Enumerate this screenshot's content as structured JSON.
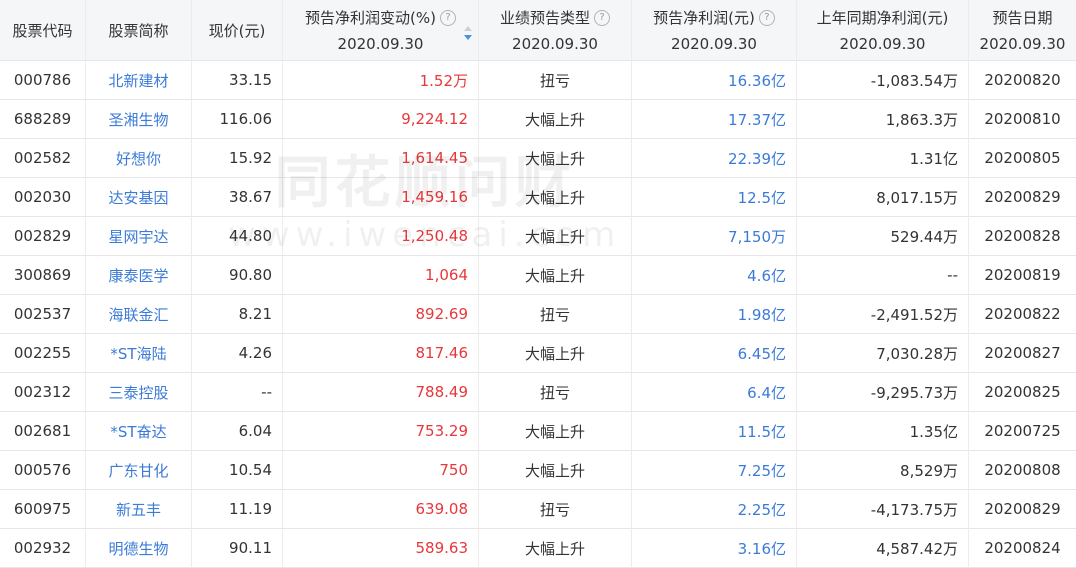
{
  "header": {
    "code": "股票代码",
    "name": "股票简称",
    "price": "现价(元)",
    "change": "预告净利润变动(%)",
    "change_date": "2020.09.30",
    "type": "业绩预告类型",
    "type_date": "2020.09.30",
    "profit": "预告净利润(元)",
    "profit_date": "2020.09.30",
    "prev": "上年同期净利润(元)",
    "prev_date": "2020.09.30",
    "date": "预告日期",
    "date_date": "2020.09.30"
  },
  "watermark": {
    "line1": "同花顺问财",
    "line2": "www.iwencai.com"
  },
  "colors": {
    "positive": "#e8373a",
    "link": "#3b7bd8",
    "header_bg": "#f5f6f8"
  },
  "rows": [
    {
      "code": "000786",
      "name": "北新建材",
      "price": "33.15",
      "change": "1.52万",
      "type": "扭亏",
      "profit": "16.36亿",
      "prev": "-1,083.54万",
      "date": "20200820"
    },
    {
      "code": "688289",
      "name": "圣湘生物",
      "price": "116.06",
      "change": "9,224.12",
      "type": "大幅上升",
      "profit": "17.37亿",
      "prev": "1,863.3万",
      "date": "20200810"
    },
    {
      "code": "002582",
      "name": "好想你",
      "price": "15.92",
      "change": "1,614.45",
      "type": "大幅上升",
      "profit": "22.39亿",
      "prev": "1.31亿",
      "date": "20200805"
    },
    {
      "code": "002030",
      "name": "达安基因",
      "price": "38.67",
      "change": "1,459.16",
      "type": "大幅上升",
      "profit": "12.5亿",
      "prev": "8,017.15万",
      "date": "20200829"
    },
    {
      "code": "002829",
      "name": "星网宇达",
      "price": "44.80",
      "change": "1,250.48",
      "type": "大幅上升",
      "profit": "7,150万",
      "prev": "529.44万",
      "date": "20200828"
    },
    {
      "code": "300869",
      "name": "康泰医学",
      "price": "90.80",
      "change": "1,064",
      "type": "大幅上升",
      "profit": "4.6亿",
      "prev": "--",
      "date": "20200819"
    },
    {
      "code": "002537",
      "name": "海联金汇",
      "price": "8.21",
      "change": "892.69",
      "type": "扭亏",
      "profit": "1.98亿",
      "prev": "-2,491.52万",
      "date": "20200822"
    },
    {
      "code": "002255",
      "name": "*ST海陆",
      "price": "4.26",
      "change": "817.46",
      "type": "大幅上升",
      "profit": "6.45亿",
      "prev": "7,030.28万",
      "date": "20200827"
    },
    {
      "code": "002312",
      "name": "三泰控股",
      "price": "--",
      "change": "788.49",
      "type": "扭亏",
      "profit": "6.4亿",
      "prev": "-9,295.73万",
      "date": "20200825"
    },
    {
      "code": "002681",
      "name": "*ST奋达",
      "price": "6.04",
      "change": "753.29",
      "type": "大幅上升",
      "profit": "11.5亿",
      "prev": "1.35亿",
      "date": "20200725"
    },
    {
      "code": "000576",
      "name": "广东甘化",
      "price": "10.54",
      "change": "750",
      "type": "大幅上升",
      "profit": "7.25亿",
      "prev": "8,529万",
      "date": "20200808"
    },
    {
      "code": "600975",
      "name": "新五丰",
      "price": "11.19",
      "change": "639.08",
      "type": "扭亏",
      "profit": "2.25亿",
      "prev": "-4,173.75万",
      "date": "20200829"
    },
    {
      "code": "002932",
      "name": "明德生物",
      "price": "90.11",
      "change": "589.63",
      "type": "大幅上升",
      "profit": "3.16亿",
      "prev": "4,587.42万",
      "date": "20200824"
    }
  ]
}
